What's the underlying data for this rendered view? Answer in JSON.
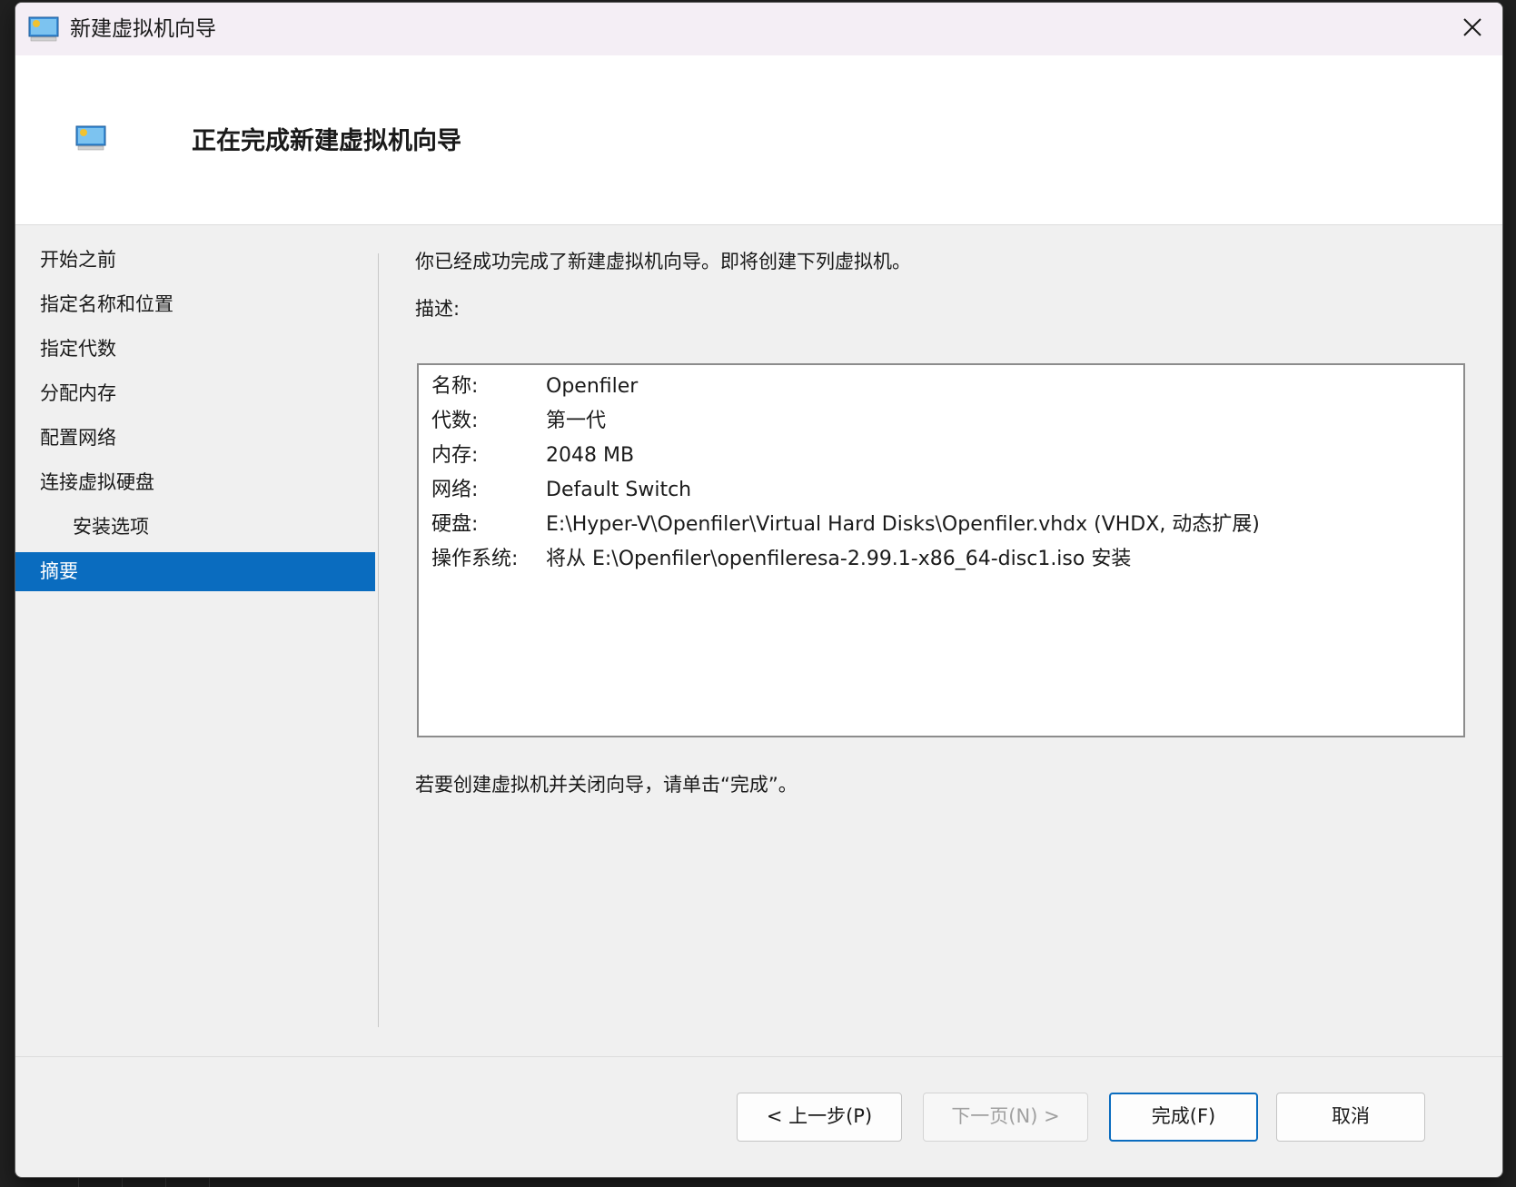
{
  "window": {
    "title": "新建虚拟机向导",
    "close_icon": "close-icon"
  },
  "header": {
    "title": "正在完成新建虚拟机向导",
    "icon": "virtual-machine-icon"
  },
  "sidebar": {
    "items": [
      {
        "label": "开始之前"
      },
      {
        "label": "指定名称和位置"
      },
      {
        "label": "指定代数"
      },
      {
        "label": "分配内存"
      },
      {
        "label": "配置网络"
      },
      {
        "label": "连接虚拟硬盘"
      },
      {
        "label": "安装选项"
      },
      {
        "label": "摘要"
      }
    ],
    "active_index": 7,
    "active_color": "#0a6cbf"
  },
  "main": {
    "intro": "你已经成功完成了新建虚拟机向导。即将创建下列虚拟机。",
    "description_label": "描述:",
    "summary": [
      {
        "key": "名称:",
        "value": "Openfiler"
      },
      {
        "key": "代数:",
        "value": "第一代"
      },
      {
        "key": "内存:",
        "value": "2048 MB"
      },
      {
        "key": "网络:",
        "value": "Default Switch"
      },
      {
        "key": "硬盘:",
        "value": "E:\\Hyper-V\\Openfiler\\Virtual Hard Disks\\Openfiler.vhdx (VHDX, 动态扩展)"
      },
      {
        "key": "操作系统:",
        "value": "将从 E:\\Openfiler\\openfileresa-2.99.1-x86_64-disc1.iso 安装"
      }
    ],
    "finish_hint": "若要创建虚拟机并关闭向导，请单击“完成”。"
  },
  "buttons": {
    "back": "< 上一步(P)",
    "next": "下一页(N) >",
    "finish": "完成(F)",
    "cancel": "取消"
  }
}
